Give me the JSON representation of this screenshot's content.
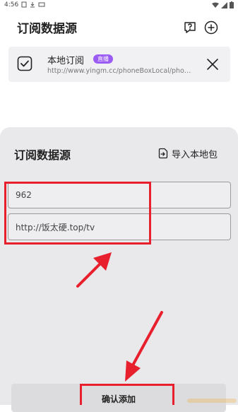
{
  "status_bar": {
    "time": "4:56"
  },
  "header": {
    "title": "订阅数据源"
  },
  "subscription": {
    "name": "本地订阅",
    "badge": "直播",
    "url": "http://www.yingm.cc/phoneBoxLocal/phoneBoxLocal.json"
  },
  "sheet": {
    "title": "订阅数据源",
    "import_label": "导入本地包",
    "name_field": {
      "value": "962"
    },
    "url_field": {
      "value": "http://饭太硬.top/tv"
    },
    "confirm_label": "确认添加"
  },
  "annotation_color": "#e8202e",
  "icons": {
    "help": "help-icon",
    "add": "add-icon",
    "check": "checkbox-checked-icon",
    "close": "close-icon",
    "import": "import-icon"
  }
}
